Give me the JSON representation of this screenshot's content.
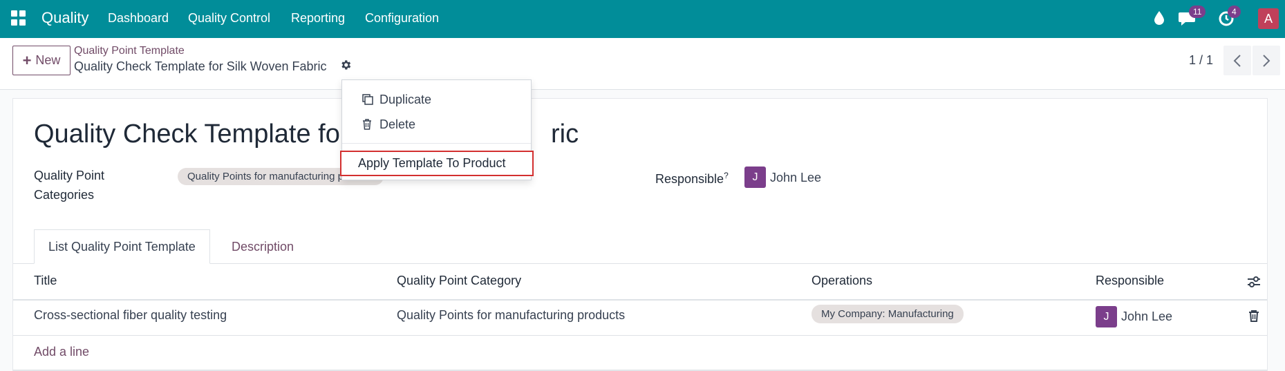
{
  "navbar": {
    "brand": "Quality",
    "menu": [
      "Dashboard",
      "Quality Control",
      "Reporting",
      "Configuration"
    ],
    "messages_badge": "11",
    "activities_badge": "4",
    "user_initial": "A",
    "bg_color": "#018d99"
  },
  "control_panel": {
    "new_label": "New",
    "breadcrumb_parent": "Quality Point Template",
    "breadcrumb_current": "Quality Check Template for Silk Woven Fabric",
    "pager": "1 / 1"
  },
  "dropdown": {
    "duplicate": "Duplicate",
    "delete": "Delete",
    "apply": "Apply Template To Product"
  },
  "form": {
    "title_left": "Quality Check Template for",
    "title_right": "ric",
    "categories_label_1": "Quality Point",
    "categories_label_2": "Categories",
    "category_tag": "Quality Points for manufacturing products",
    "responsible_label": "Responsible",
    "responsible_help": "?",
    "responsible_initial": "J",
    "responsible_name": "John Lee"
  },
  "tabs": [
    "List Quality Point Template",
    "Description"
  ],
  "table": {
    "headers": [
      "Title",
      "Quality Point Category",
      "Operations",
      "Responsible"
    ],
    "rows": [
      {
        "title": "Cross-sectional fiber quality testing",
        "category": "Quality Points for manufacturing products",
        "operation": "My Company: Manufacturing",
        "responsible_initial": "J",
        "responsible": "John Lee"
      }
    ],
    "add_line": "Add a line"
  }
}
